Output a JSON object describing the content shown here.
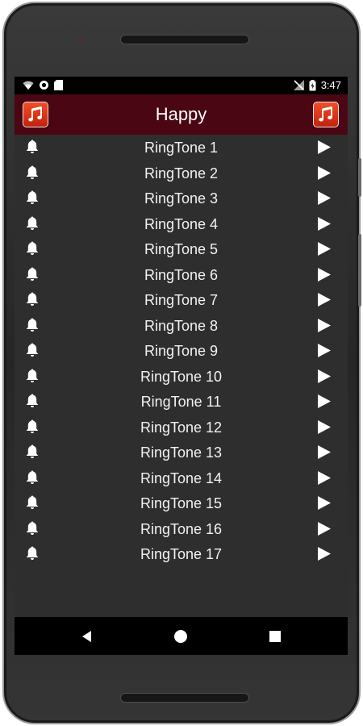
{
  "statusbar": {
    "time": "3:47",
    "icons": [
      "wifi-icon",
      "sync-icon",
      "sd-card-icon",
      "no-signal-icon",
      "battery-icon"
    ]
  },
  "appbar": {
    "title": "Happy",
    "left_button_icon": "music-note-icon",
    "right_button_icon": "music-note-icon",
    "accent_color": "#4a0612"
  },
  "ringtones": [
    {
      "label": "RingTone 1"
    },
    {
      "label": "RingTone 2"
    },
    {
      "label": "RingTone 3"
    },
    {
      "label": "RingTone 4"
    },
    {
      "label": "RingTone 5"
    },
    {
      "label": "RingTone 6"
    },
    {
      "label": "RingTone 7"
    },
    {
      "label": "RingTone 8"
    },
    {
      "label": "RingTone 9"
    },
    {
      "label": "RingTone 10"
    },
    {
      "label": "RingTone 11"
    },
    {
      "label": "RingTone 12"
    },
    {
      "label": "RingTone 13"
    },
    {
      "label": "RingTone 14"
    },
    {
      "label": "RingTone 15"
    },
    {
      "label": "RingTone 16"
    },
    {
      "label": "RingTone 17"
    }
  ],
  "row_icons": {
    "set_ringtone": "bell-icon",
    "play": "play-icon"
  },
  "navbar": {
    "icons": [
      "back-icon",
      "home-icon",
      "recents-icon"
    ]
  }
}
